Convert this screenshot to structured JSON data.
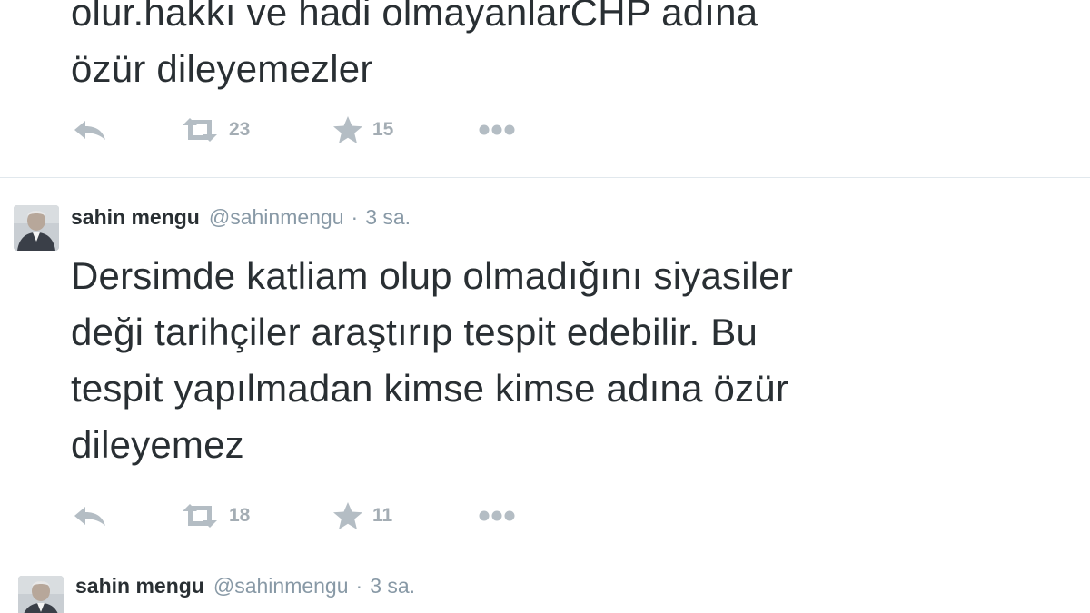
{
  "tweets": [
    {
      "text_lines": "olur.hakkı ve hadi olmayanlarCHP adına\nözür dileyemezler",
      "retweet_count": "23",
      "favorite_count": "15",
      "icons": [
        "reply-icon",
        "retweet-icon",
        "favorite-icon",
        "more-icon"
      ]
    },
    {
      "name": "sahin mengu",
      "handle": "@sahinmengu",
      "separator": "·",
      "time": "3 sa.",
      "text_lines": "Dersimde katliam olup olmadığını siyasiler\ndeği tarihçiler araştırıp tespit edebilir. Bu\ntespit yapılmadan kimse kimse adına özür\ndileyemez",
      "retweet_count": "18",
      "favorite_count": "11",
      "icons": [
        "reply-icon",
        "retweet-icon",
        "favorite-icon",
        "more-icon"
      ]
    },
    {
      "name": "sahin mengu",
      "handle": "@sahinmengu",
      "separator": "·",
      "time": "3 sa."
    }
  ],
  "colors": {
    "text": "#292f33",
    "muted": "#8899a6",
    "icon": "#b4bdc4",
    "divider": "#e1e8ed"
  }
}
